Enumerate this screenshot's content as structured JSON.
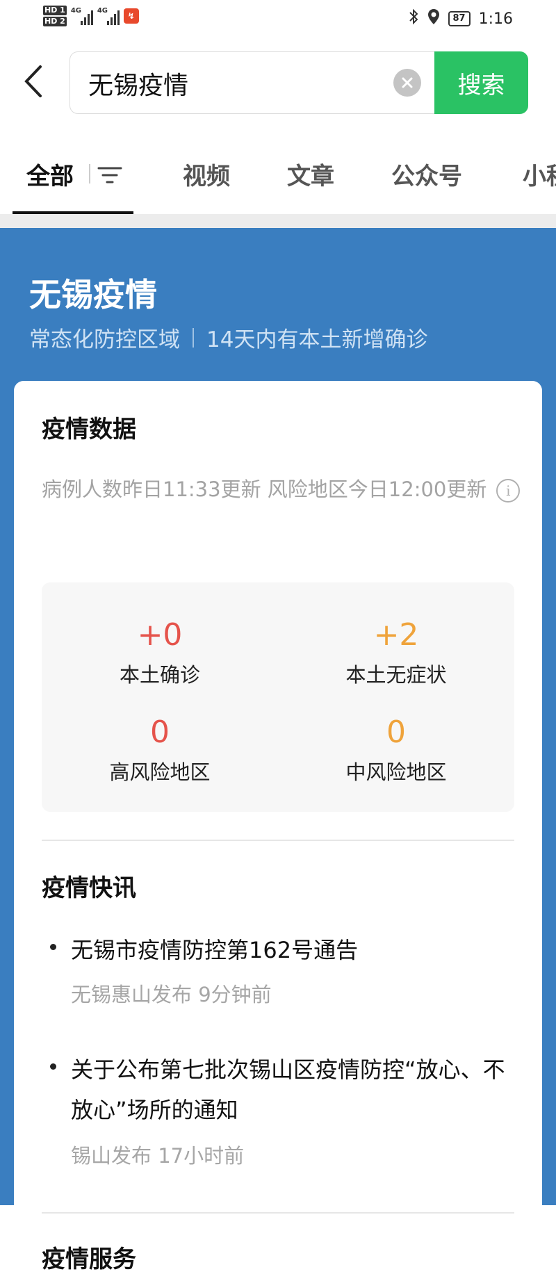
{
  "status_bar": {
    "hd1": "HD 1",
    "hd2": "HD 2",
    "net1": "4G",
    "net2": "4G",
    "battery": "87",
    "time": "1:16"
  },
  "search": {
    "query": "无锡疫情",
    "button": "搜索"
  },
  "tabs": [
    {
      "label": "全部",
      "active": true
    },
    {
      "label": "视频"
    },
    {
      "label": "文章"
    },
    {
      "label": "公众号"
    },
    {
      "label": "小程"
    }
  ],
  "hero": {
    "title": "无锡疫情",
    "subtitle_left": "常态化防控区域",
    "subtitle_right": "14天内有本土新增确诊"
  },
  "epidemic_data": {
    "title": "疫情数据",
    "update_note": "病例人数昨日11:33更新 风险地区今日12:00更新",
    "stats": [
      {
        "value": "+0",
        "label": "本土确诊",
        "color": "#e5534b"
      },
      {
        "value": "+2",
        "label": "本土无症状",
        "color": "#efa33b"
      },
      {
        "value": "0",
        "label": "高风险地区",
        "color": "#e5534b"
      },
      {
        "value": "0",
        "label": "中风险地区",
        "color": "#efa33b"
      }
    ]
  },
  "news": {
    "title": "疫情快讯",
    "items": [
      {
        "title": "无锡市疫情防控第162号通告",
        "meta": "无锡惠山发布 9分钟前"
      },
      {
        "title": "关于公布第七批次锡山区疫情防控“放心、不放心”场所的通知",
        "meta": "锡山发布 17小时前"
      }
    ]
  },
  "services": {
    "title": "疫情服务"
  },
  "colors": {
    "accent_green": "#2ac264",
    "hero_blue": "#3a7ec0",
    "red": "#e5534b",
    "orange": "#efa33b"
  }
}
